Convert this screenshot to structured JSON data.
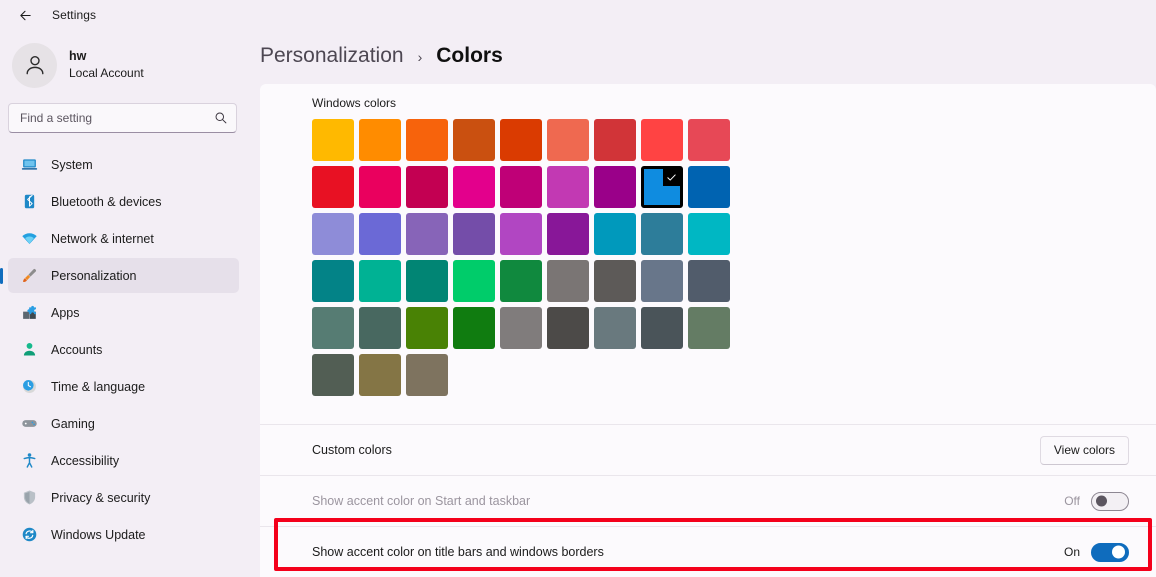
{
  "titlebar": {
    "back_label": "←",
    "title": "Settings"
  },
  "account": {
    "name": "hw",
    "type": "Local Account",
    "avatar_icon": "person-icon"
  },
  "search": {
    "placeholder": "Find a setting",
    "value": "",
    "icon": "search-icon"
  },
  "sidebar": {
    "items": [
      {
        "label": "System",
        "icon": "laptop-icon",
        "selected": false
      },
      {
        "label": "Bluetooth & devices",
        "icon": "bluetooth-icon",
        "selected": false
      },
      {
        "label": "Network & internet",
        "icon": "wifi-icon",
        "selected": false
      },
      {
        "label": "Personalization",
        "icon": "paintbrush-icon",
        "selected": true
      },
      {
        "label": "Apps",
        "icon": "apps-icon",
        "selected": false
      },
      {
        "label": "Accounts",
        "icon": "person-icon",
        "selected": false
      },
      {
        "label": "Time & language",
        "icon": "clock-icon",
        "selected": false
      },
      {
        "label": "Gaming",
        "icon": "gamepad-icon",
        "selected": false
      },
      {
        "label": "Accessibility",
        "icon": "accessibility-icon",
        "selected": false
      },
      {
        "label": "Privacy & security",
        "icon": "shield-icon",
        "selected": false
      },
      {
        "label": "Windows Update",
        "icon": "update-icon",
        "selected": false
      }
    ]
  },
  "breadcrumb": {
    "parent": "Personalization",
    "separator": "›",
    "current": "Colors"
  },
  "windows_colors": {
    "label": "Windows colors",
    "selected_index": 16,
    "swatches": [
      "#ffb900",
      "#ff8c00",
      "#f7630c",
      "#ca5010",
      "#da3b01",
      "#ef6950",
      "#d13438",
      "#ff4343",
      "#e74856",
      "#e81123",
      "#ea005e",
      "#c30052",
      "#e3008c",
      "#bf0077",
      "#c239b3",
      "#9a0089",
      "#0f8ce0",
      "#0063b1",
      "#8e8cd8",
      "#6b69d6",
      "#8764b8",
      "#744da9",
      "#b146c2",
      "#881798",
      "#0099bc",
      "#2d7d9a",
      "#00b7c3",
      "#038387",
      "#00b294",
      "#018574",
      "#00cc6a",
      "#10893e",
      "#7a7574",
      "#5d5a58",
      "#68768a",
      "#515c6b",
      "#567c73",
      "#486860",
      "#498205",
      "#107c10",
      "#807c7c",
      "#4c4a48",
      "#69797e",
      "#4a5459",
      "#647c64",
      "#525e54",
      "#847545",
      "#7e735f"
    ]
  },
  "rows": [
    {
      "label": "Custom colors",
      "control": "button",
      "button_label": "View colors",
      "disabled": false
    },
    {
      "label": "Show accent color on Start and taskbar",
      "control": "toggle",
      "state_text": "Off",
      "state_on": false,
      "disabled": true
    },
    {
      "label": "Show accent color on title bars and windows borders",
      "control": "toggle",
      "state_text": "On",
      "state_on": true,
      "disabled": false,
      "highlighted": true
    }
  ],
  "colors": {
    "accent": "#0f6cbd",
    "annotation": "#f4001b",
    "page_background": "#f3eef5",
    "card_background": "#fcfafd"
  }
}
